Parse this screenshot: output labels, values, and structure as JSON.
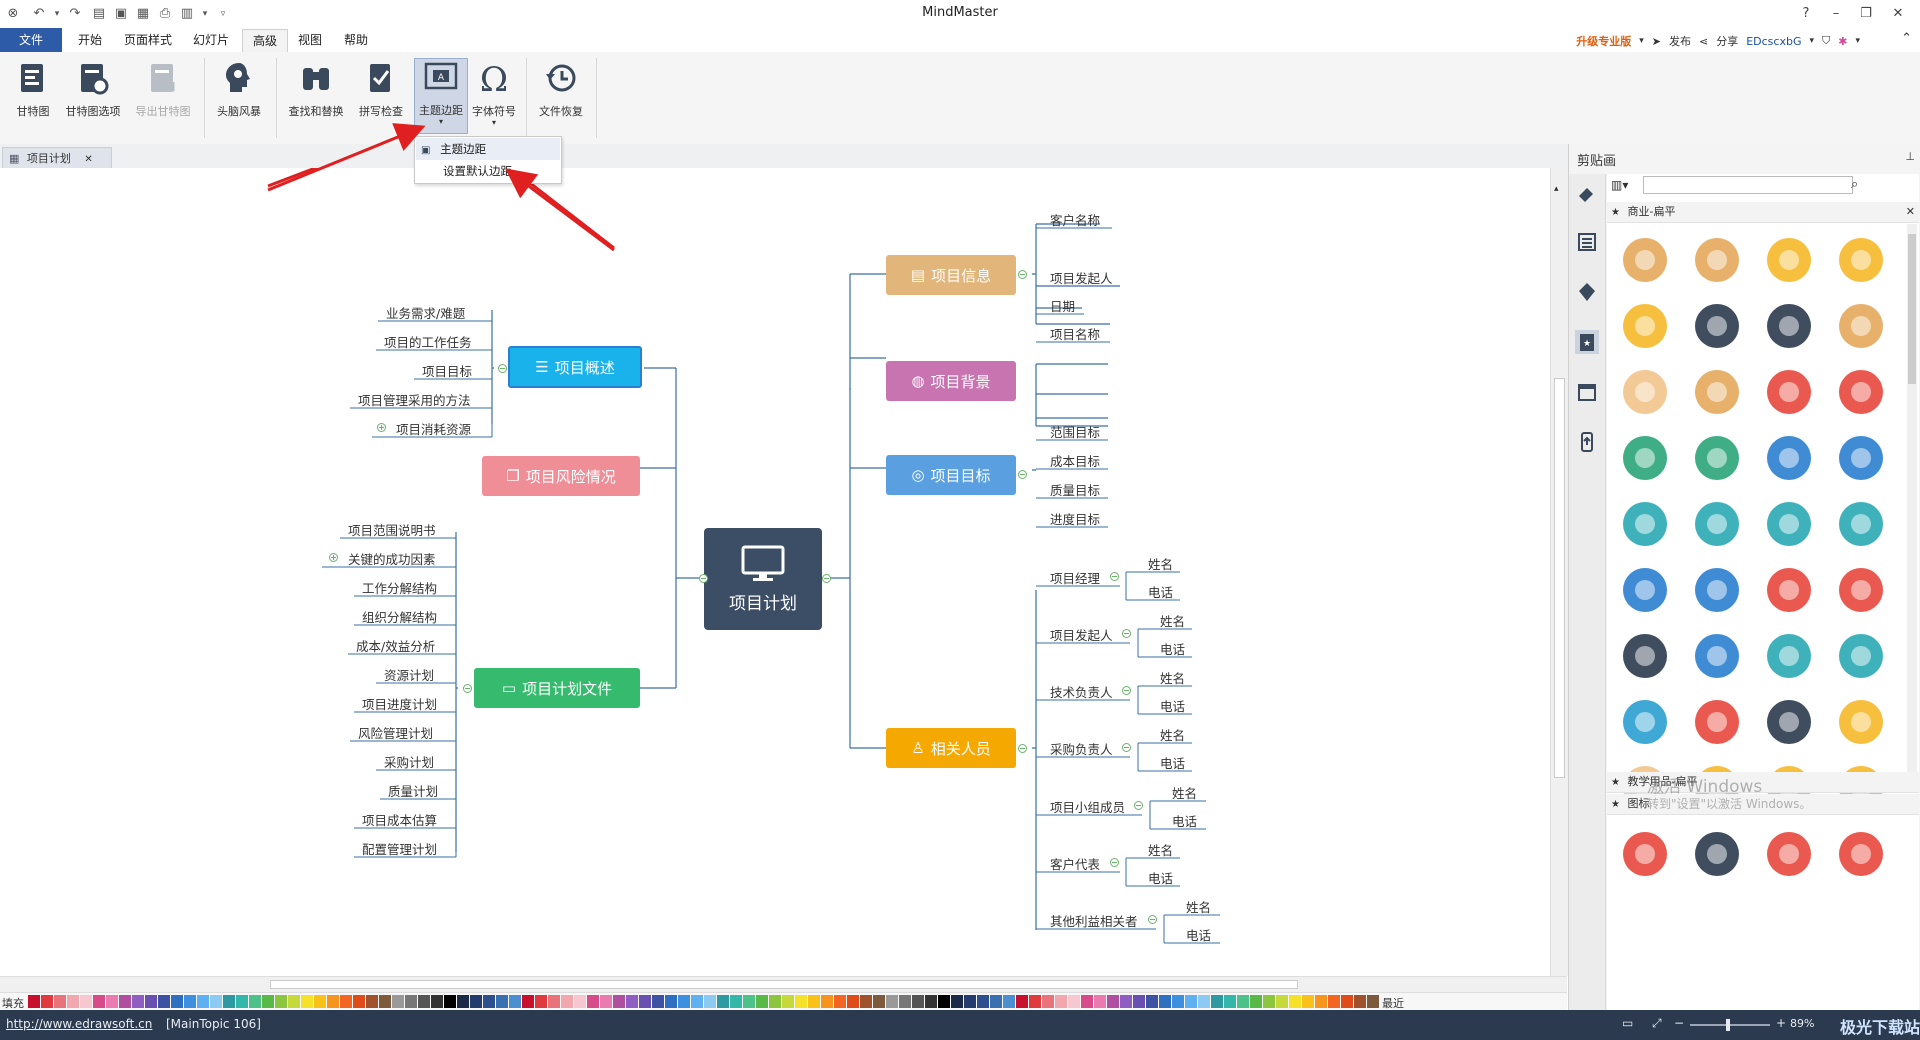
{
  "app": {
    "title": "MindMaster"
  },
  "menu": {
    "items": [
      "文件",
      "开始",
      "页面样式",
      "幻灯片",
      "高级",
      "视图",
      "帮助"
    ],
    "active": "高级"
  },
  "account": {
    "upgrade": "升级专业版",
    "publish": "发布",
    "share": "分享",
    "user": "EDcscxbG"
  },
  "ribbon": {
    "buttons": [
      "甘特图",
      "甘特图选项",
      "导出甘特图",
      "头脑风暴",
      "查找和替换",
      "拼写检查",
      "主题边距",
      "字体符号",
      "文件恢复"
    ],
    "pressed": "主题边距",
    "disabled": [
      "导出甘特图"
    ]
  },
  "dropdown": {
    "items": [
      "主题边距",
      "设置默认边距"
    ]
  },
  "doc_tab": {
    "label": "项目计划",
    "close": "✕"
  },
  "clipboard": {
    "title": "剪贴画",
    "search_value": "",
    "library": "商业-扁平",
    "footer_libs": [
      "教学用品-扁平",
      "图标"
    ]
  },
  "mindmap": {
    "central": "项目计划",
    "topics": {
      "info": {
        "label": "项目信息",
        "children": [
          "客户名称",
          "项目发起人",
          "日期",
          "项目名称"
        ]
      },
      "background": {
        "label": "项目背景"
      },
      "goal": {
        "label": "项目目标",
        "children": [
          "范围目标",
          "成本目标",
          "质量目标",
          "进度目标"
        ]
      },
      "people": {
        "label": "相关人员",
        "groups": [
          {
            "role": "项目经理",
            "fields": [
              "姓名",
              "电话"
            ]
          },
          {
            "role": "项目发起人",
            "fields": [
              "姓名",
              "电话"
            ]
          },
          {
            "role": "技术负责人",
            "fields": [
              "姓名",
              "电话"
            ]
          },
          {
            "role": "采购负责人",
            "fields": [
              "姓名",
              "电话"
            ]
          },
          {
            "role": "项目小组成员",
            "fields": [
              "姓名",
              "电话"
            ]
          },
          {
            "role": "客户代表",
            "fields": [
              "姓名",
              "电话"
            ]
          },
          {
            "role": "其他利益相关者",
            "fields": [
              "姓名",
              "电话"
            ]
          }
        ]
      },
      "overview": {
        "label": "项目概述",
        "children": [
          "业务需求/难题",
          "项目的工作任务",
          "项目目标",
          "项目管理采用的方法",
          "项目消耗资源"
        ]
      },
      "risk": {
        "label": "项目风险情况"
      },
      "docs": {
        "label": "项目计划文件",
        "children": [
          "项目范围说明书",
          "关键的成功因素",
          "工作分解结构",
          "组织分解结构",
          "成本/效益分析",
          "资源计划",
          "项目进度计划",
          "风险管理计划",
          "采购计划",
          "质量计划",
          "项目成本估算",
          "配置管理计划"
        ]
      }
    }
  },
  "palette": {
    "label": "填充",
    "recent": "最近"
  },
  "status": {
    "url": "http://www.edrawsoft.cn",
    "selection": "[MainTopic 106]",
    "zoom": "89%"
  },
  "watermark": {
    "line1": "激活 Windows",
    "line2": "转到\"设置\"以激活 Windows。",
    "site": "极光下载站"
  },
  "colors": {
    "info": "#e2b57a",
    "background": "#c774b0",
    "goal": "#5aa0e0",
    "people": "#f5a800",
    "overview": "#1ab2ea",
    "risk": "#f08e98",
    "docs": "#36bb6e",
    "central": "#3c4e66",
    "line": "#3a6fa5",
    "arrow": "#e02020"
  }
}
